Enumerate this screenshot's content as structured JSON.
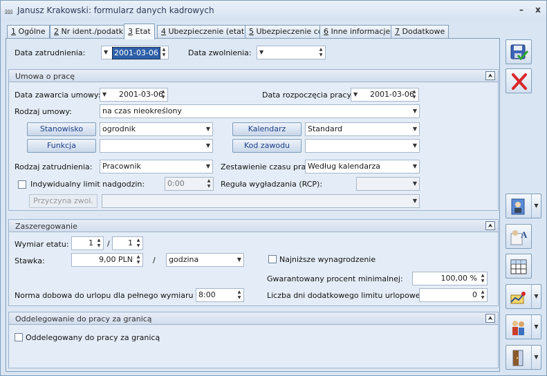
{
  "window": {
    "title": "Janusz Krakowski: formularz danych kadrowych",
    "minimize": "–",
    "close": "x"
  },
  "tabs": [
    {
      "num": "1",
      "label": " Ogólne"
    },
    {
      "num": "2",
      "label": " Nr ident./podatki"
    },
    {
      "num": "3",
      "label": " Etat"
    },
    {
      "num": "4",
      "label": " Ubezpieczenie (etat)"
    },
    {
      "num": "5",
      "label": " Ubezpieczenie cd"
    },
    {
      "num": "6",
      "label": " Inne informacje"
    },
    {
      "num": "7",
      "label": " Dodatkowe"
    }
  ],
  "top": {
    "hire_label": "Data zatrudnienia:",
    "hire_value": "2001-03-06",
    "release_label": "Data zwolnienia:",
    "release_value": ""
  },
  "contract": {
    "title": "Umowa o pracę",
    "conclusion_label": "Data zawarcia umowy:",
    "conclusion_value": "2001-03-06",
    "start_label": "Data rozpoczęcia pracy:",
    "start_value": "2001-03-06",
    "type_label": "Rodzaj umowy:",
    "type_value": "na czas nieokreślony",
    "position_btn": "Stanowisko",
    "position_value": "ogrodnik",
    "function_btn": "Funkcja",
    "function_value": "",
    "calendar_btn": "Kalendarz",
    "calendar_value": "Standard",
    "profession_btn": "Kod zawodu",
    "profession_value": "",
    "employment_label": "Rodzaj zatrudnienia:",
    "employment_value": "Pracownik",
    "worktime_label": "Zestawienie czasu pracy:",
    "worktime_value": "Według kalendarza",
    "overtime_label": "Indywidualny limit nadgodzin:",
    "overtime_value": "0:00",
    "rcp_label": "Reguła wygładzania (RCP):",
    "rcp_value": "",
    "release_reason_btn": "Przyczyna zwol.",
    "release_reason_value": ""
  },
  "grade": {
    "title": "Zaszeregowanie",
    "fte_label": "Wymiar etatu:",
    "fte_num": "1",
    "fte_sep": "/",
    "fte_den": "1",
    "rate_label": "Stawka:",
    "rate_value": "9,00 PLN",
    "rate_sep": "/",
    "rate_unit": "godzina",
    "min_wage_label": "Najniższe wynagrodzenie",
    "guaranteed_label": "Gwarantowany procent minimalnej:",
    "guaranteed_value": "100,00 %",
    "norm_label": "Norma dobowa do urlopu dla pełnego wymiaru etatu:",
    "norm_value": "8:00",
    "extra_days_label": "Liczba dni dodatkowego limitu urlopowego:",
    "extra_days_value": "0"
  },
  "delegation": {
    "title": "Oddelegowanie do pracy za granicą",
    "checkbox_label": "Oddelegowany do pracy za granicą"
  },
  "icons": {
    "save": "save-icon",
    "cancel": "cancel-icon",
    "collapse": "collapse-icon"
  },
  "colors": {
    "accent": "#1d3f8a",
    "cancel": "#d9262a",
    "save_check": "#2fa42f"
  }
}
